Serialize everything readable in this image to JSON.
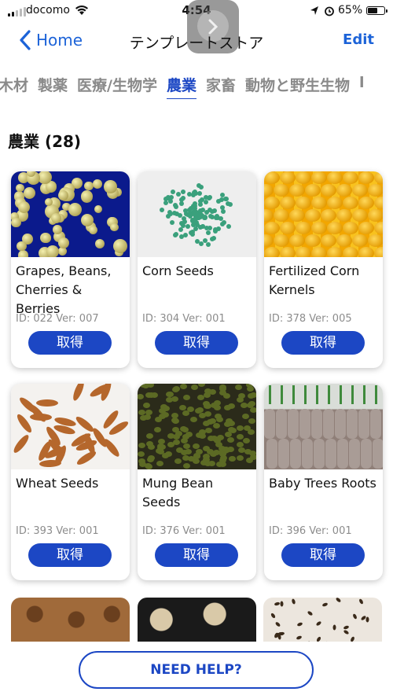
{
  "status_bar": {
    "carrier": "docomo",
    "time": "4:54",
    "battery_percent": "65%",
    "battery_level": 0.65
  },
  "nav": {
    "back_label": "Home",
    "title": "テンプレートストア",
    "edit_label": "Edit"
  },
  "tabs": [
    {
      "label": "木材",
      "active": false
    },
    {
      "label": "製薬",
      "active": false
    },
    {
      "label": "医療/生物学",
      "active": false
    },
    {
      "label": "農業",
      "active": true
    },
    {
      "label": "家畜",
      "active": false
    },
    {
      "label": "動物と野生生物",
      "active": false
    },
    {
      "label": "l",
      "active": false
    }
  ],
  "section": {
    "title": "農業 (28)"
  },
  "cards": [
    {
      "title": "Grapes, Beans, Cherries & Berries",
      "id_text": "ID: 022 Ver: 007",
      "button": "取得",
      "image_icon": "grapes-beans-photo"
    },
    {
      "title": "Corn Seeds",
      "id_text": "ID: 304 Ver: 001",
      "button": "取得",
      "image_icon": "corn-seeds-photo"
    },
    {
      "title": "Fertilized Corn Kernels",
      "id_text": "ID: 378 Ver: 005",
      "button": "取得",
      "image_icon": "corn-kernels-photo"
    },
    {
      "title": "Wheat Seeds",
      "id_text": "ID: 393 Ver: 001",
      "button": "取得",
      "image_icon": "wheat-seeds-photo"
    },
    {
      "title": "Mung Bean Seeds",
      "id_text": "ID: 376 Ver: 001",
      "button": "取得",
      "image_icon": "mung-bean-photo"
    },
    {
      "title": "Baby Trees Roots",
      "id_text": "ID: 396 Ver: 001",
      "button": "取得",
      "image_icon": "tree-roots-photo"
    }
  ],
  "help_button": "NEED HELP?",
  "colors": {
    "accent": "#1c47c4",
    "link": "#1c63d8",
    "tab_inactive": "#8a8a8a"
  }
}
